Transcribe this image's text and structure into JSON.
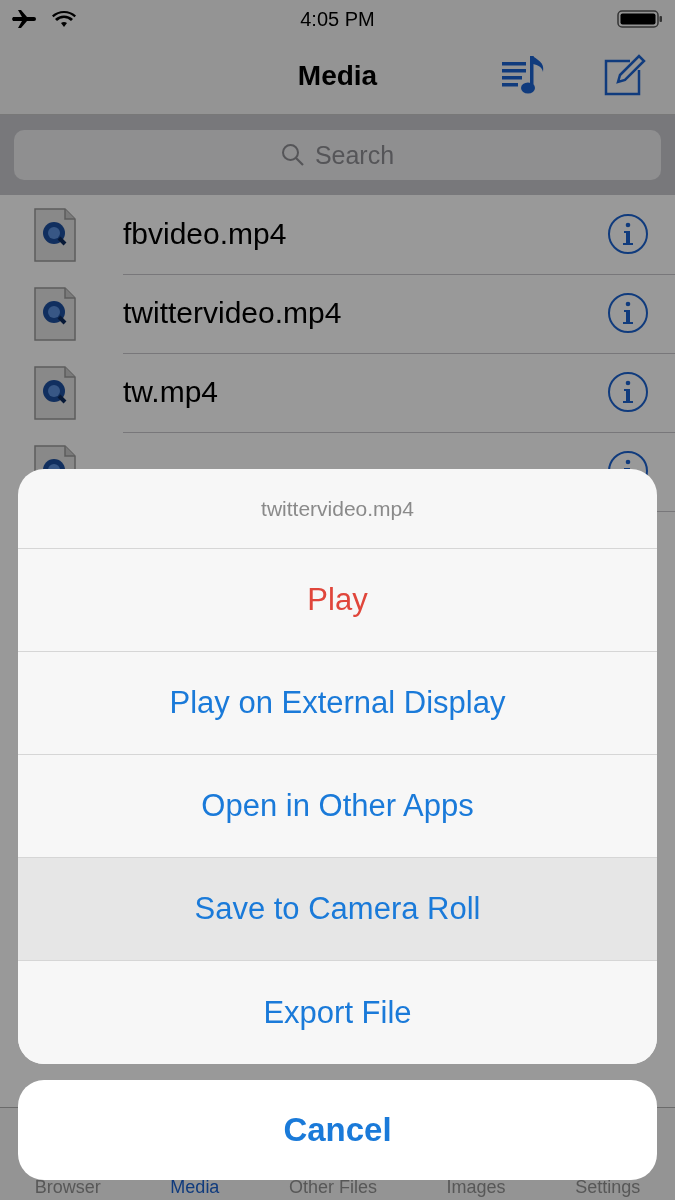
{
  "status_bar": {
    "time": "4:05 PM"
  },
  "nav": {
    "title": "Media"
  },
  "search": {
    "placeholder": "Search"
  },
  "files": [
    {
      "kind": "named",
      "name": "fbvideo.mp4"
    },
    {
      "kind": "named",
      "name": "twittervideo.mp4"
    },
    {
      "kind": "named",
      "name": "tw.mp4"
    },
    {
      "kind": "covered"
    }
  ],
  "tabs": [
    {
      "label": "Browser",
      "selected": false
    },
    {
      "label": "Media",
      "selected": true
    },
    {
      "label": "Other Files",
      "selected": false
    },
    {
      "label": "Images",
      "selected": false
    },
    {
      "label": "Settings",
      "selected": false
    }
  ],
  "action_sheet": {
    "title": "twittervideo.mp4",
    "actions": [
      {
        "label": "Play",
        "kind": "destructive",
        "selected": false
      },
      {
        "label": "Play on External Display",
        "kind": "default",
        "selected": false
      },
      {
        "label": "Open in Other Apps",
        "kind": "default",
        "selected": false
      },
      {
        "label": "Save to Camera Roll",
        "kind": "default",
        "selected": true
      },
      {
        "label": "Export File",
        "kind": "default",
        "selected": false
      }
    ],
    "cancel": "Cancel"
  }
}
